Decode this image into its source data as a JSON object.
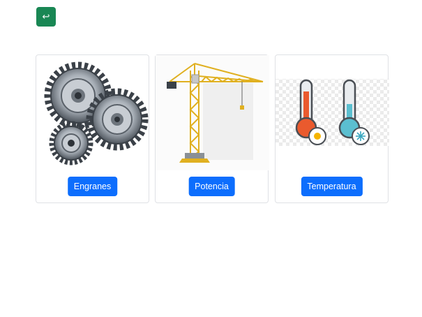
{
  "back_button": {
    "icon": "return-arrow-icon",
    "glyph": "↩",
    "color": "#198754"
  },
  "cards": [
    {
      "image": "gears-image",
      "button_label": "Engranes"
    },
    {
      "image": "crane-image",
      "button_label": "Potencia"
    },
    {
      "image": "thermometers-image",
      "button_label": "Temperatura"
    }
  ],
  "colors": {
    "primary": "#0d6efd",
    "success": "#198754"
  }
}
